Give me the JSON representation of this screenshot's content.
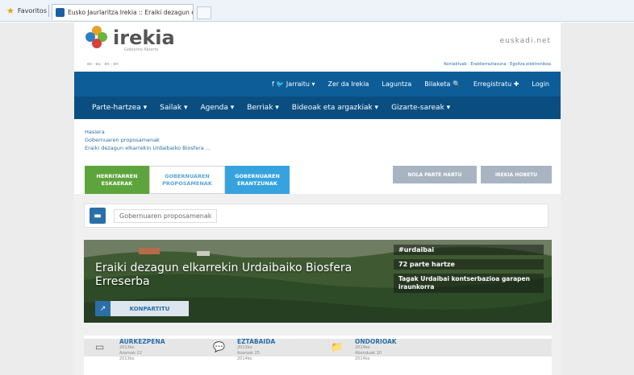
{
  "browser": {
    "favorites_label": "Favoritos",
    "tab_title": "Eusko Jaurlaritza Irekia :: Eraiki dezagun elkarrekin Ur..."
  },
  "header": {
    "logo_text": "irekia",
    "logo_sub": "Gobierno Abierto",
    "partner_logo": "euskadi.net",
    "langs": "es · eu · en · en",
    "top_links": "Kontaktuak · Erabilerraztasuna · Egoitza elektronikoa"
  },
  "nav1": {
    "items": [
      "f 🐦 Jarraitu ▾",
      "Zer da Irekia",
      "Laguntza",
      "Bilaketa 🔍",
      "Erregistratu ✚",
      "Login"
    ]
  },
  "nav2": {
    "items": [
      "Parte-hartzea ▾",
      "Sailak ▾",
      "Agenda ▾",
      "Berriak ▾",
      "Bideoak eta argazkiak ▾",
      "Gizarte-sareak ▾"
    ]
  },
  "breadcrumb": {
    "items": [
      "Hasiera",
      "Gobernuaren proposamenak",
      "Eraiki dezagun elkarrekin Urdaibaiko Biosfera ..."
    ]
  },
  "tabs": {
    "herri": "HERRITARREN ESKAERAK",
    "gob": "GOBERNUAREN PROPOSAMENAK",
    "eran": "GOBERNUAREN ERANTZUNAK"
  },
  "buttons": {
    "nola": "NOLA PARTE HARTU",
    "hobetu": "IREKIA HOBETU"
  },
  "section": {
    "title": "Gobernuaren proposamenak"
  },
  "hero": {
    "title": "Eraiki dezagun elkarrekin Urdaibaiko Biosfera Erreserba",
    "hashtag": "#urdaibai",
    "count": "72 parte hartze",
    "tags": "Tagak Urdaibai kontserbazioa garapen iraunkorra",
    "share_label": "KONPARTITU"
  },
  "steps": [
    {
      "name": "AURKEZPENA",
      "d1": "2013ko",
      "d2": "Azaroak 22",
      "d3": "2013ko"
    },
    {
      "name": "EZTABAIDA",
      "d1": "2013ko",
      "d2": "Azaroak 25",
      "d3": "2014ko"
    },
    {
      "name": "ONDORIOAK",
      "d1": "2014ko",
      "d2": "Abenduak 10",
      "d3": "2014ko"
    }
  ]
}
